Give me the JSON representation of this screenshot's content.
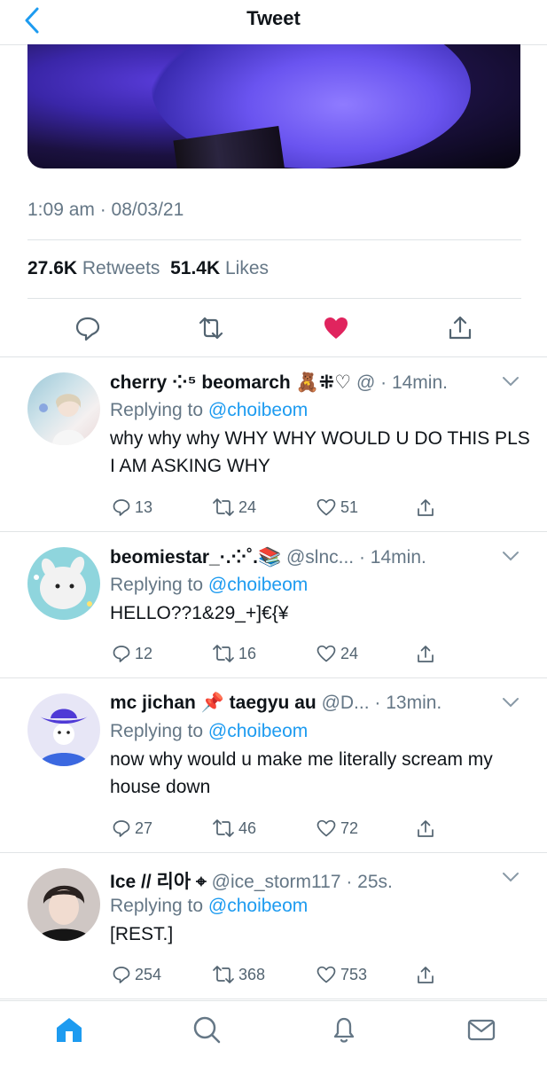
{
  "header": {
    "title": "Tweet",
    "back_icon": "chevron-left-icon"
  },
  "tweet": {
    "timestamp": "1:09 am · 08/03/21",
    "retweets": "27.6K",
    "retweets_label": "Retweets",
    "likes": "51.4K",
    "likes_label": "Likes",
    "liked": true,
    "like_color": "#e0245e"
  },
  "replies": [
    {
      "name": "cherry ⁘⁵ beomarch 🧸⁜♡",
      "handle": "@",
      "time": "· 14min.",
      "replying_to_label": "Replying to",
      "replying_to_handle": "@choibeom",
      "text": "why why why WHY WHY WOULD U DO THIS PLS I AM ASKING WHY",
      "replies": "13",
      "retweets": "24",
      "likes": "51"
    },
    {
      "name": "beomiestar_·.⁘˚.📚",
      "handle": "@slnc...",
      "time": "· 14min.",
      "replying_to_label": "Replying to",
      "replying_to_handle": "@choibeom",
      "text": "HELLO??1&29_+]€{¥",
      "replies": "12",
      "retweets": "16",
      "likes": "24"
    },
    {
      "name": "mc jichan 📌 taegyu au",
      "handle": "@D...",
      "time": "· 13min.",
      "replying_to_label": "Replying to",
      "replying_to_handle": "@choibeom",
      "text": "now why would u make me literally scream my house down",
      "replies": "27",
      "retweets": "46",
      "likes": "72"
    },
    {
      "name": "Ice // 리아 ⌖",
      "handle": "@ice_storm117",
      "time": "· 25s.",
      "replying_to_label": "Replying to",
      "replying_to_handle": "@choibeom",
      "text": "[REST.]",
      "replies": "254",
      "retweets": "368",
      "likes": "753"
    }
  ],
  "tabbar": {
    "items": [
      "home-icon",
      "search-icon",
      "notifications-icon",
      "messages-icon"
    ],
    "active_color": "#1d9bf0"
  }
}
